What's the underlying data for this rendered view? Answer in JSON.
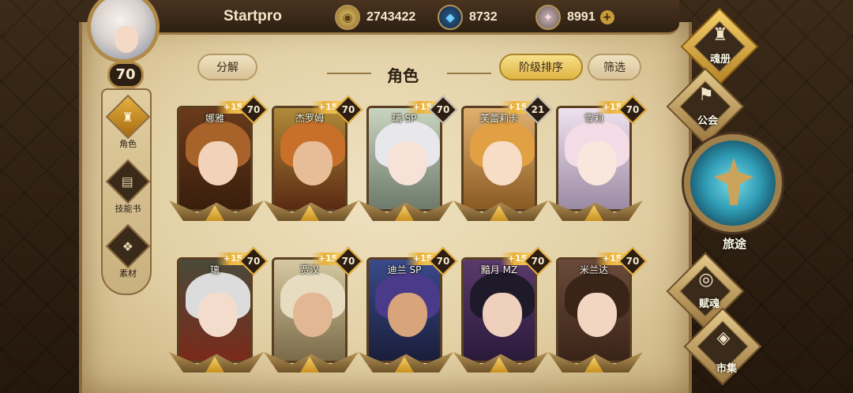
{
  "header": {
    "username": "Startpro",
    "player_level": "70",
    "gold": "2743422",
    "gems": "8732",
    "crystals": "8991",
    "plus": "+"
  },
  "leftnav": {
    "items": [
      {
        "label": "角色",
        "icon": "helmet-icon"
      },
      {
        "label": "技能书",
        "icon": "skill-book-icon"
      },
      {
        "label": "素材",
        "icon": "materials-icon"
      }
    ]
  },
  "toolbar": {
    "decompose": "分解",
    "title": "角色",
    "sort": "阶级排序",
    "filter": "筛选"
  },
  "cards": [
    {
      "name": "娜雅",
      "plus": "+15",
      "level": "70"
    },
    {
      "name": "杰罗姆",
      "plus": "+15",
      "level": "70"
    },
    {
      "name": "璃 SP",
      "plus": "+15",
      "level": "70"
    },
    {
      "name": "芙蕾莉卡",
      "plus": "+15",
      "level": "21"
    },
    {
      "name": "雪莉",
      "plus": "+15",
      "level": "70"
    },
    {
      "name": "璃",
      "plus": "+15",
      "level": "70"
    },
    {
      "name": "贾汉",
      "plus": "+15",
      "level": "70"
    },
    {
      "name": "迪兰 SP",
      "plus": "+15",
      "level": "70"
    },
    {
      "name": "黯月 MZ",
      "plus": "+15",
      "level": "70"
    },
    {
      "name": "米兰达",
      "plus": "+15",
      "level": "70"
    }
  ],
  "rightmenu": {
    "soul_book": "魂册",
    "guild": "公会",
    "journey": "旅途",
    "soul_gift": "赋魂",
    "market": "市集"
  },
  "colors": {
    "accent_gold": "#e9b13e",
    "parchment": "#e3d1a6",
    "frame_dark": "#2a1d12",
    "journey_teal": "#2f9cb4"
  }
}
